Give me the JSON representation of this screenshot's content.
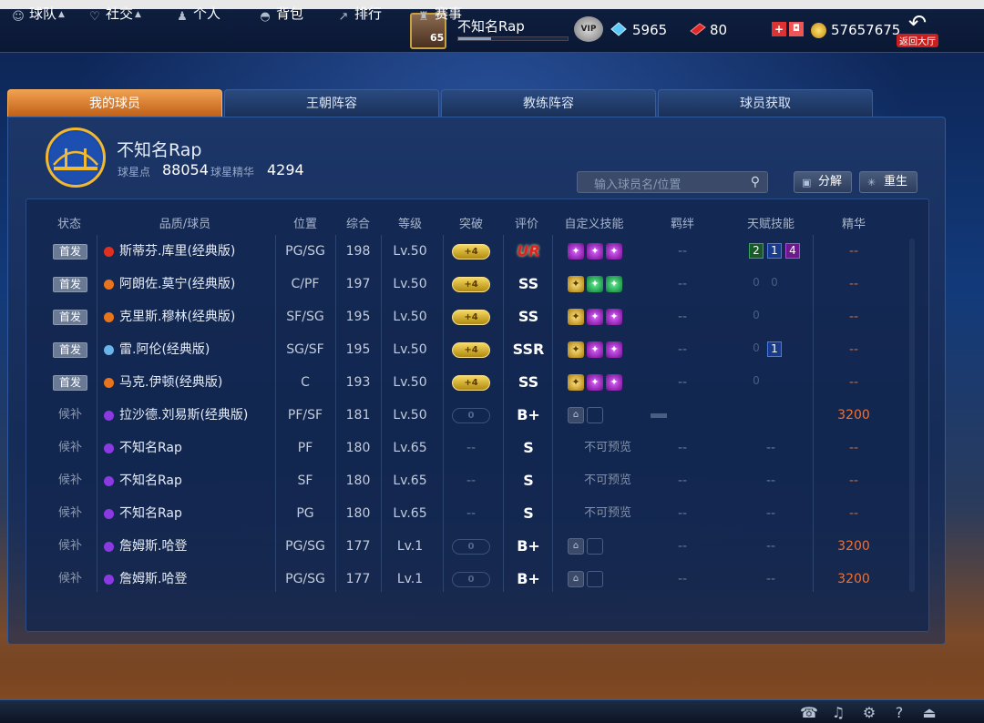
{
  "header": {
    "player_name": "不知名Rap",
    "level": "65",
    "vip_label": "VIP",
    "diamonds": "5965",
    "tickets": "80",
    "coins": "57657675",
    "back_label": "返回大厅",
    "icons": [
      "avatar",
      "vip-badge-icon",
      "diamond-icon",
      "ticket-icon",
      "shop-icon",
      "coin-icon",
      "back-arrow-icon"
    ]
  },
  "tabs": [
    {
      "label": "我的球员",
      "active": true
    },
    {
      "label": "王朝阵容",
      "active": false
    },
    {
      "label": "教练阵容",
      "active": false
    },
    {
      "label": "球员获取",
      "active": false
    }
  ],
  "team": {
    "name": "不知名Rap",
    "points_label": "球星点",
    "points": "88054",
    "essence_label": "球星精华",
    "essence": "4294"
  },
  "search": {
    "placeholder": "输入球员名/位置"
  },
  "actions": {
    "decompose": "分解",
    "rebirth": "重生"
  },
  "columns": [
    "状态",
    "品质/球员",
    "位置",
    "综合",
    "等级",
    "突破",
    "评价",
    "自定义技能",
    "羁绊",
    "天赋技能",
    "精华"
  ],
  "colors": {
    "active_tab": "#e07a2a",
    "essence_orange": "#f07030",
    "quality_red": "#e03020",
    "quality_orange": "#e8741e",
    "quality_blue": "#6ab4e8",
    "quality_purple": "#8a3ae0"
  },
  "rows": [
    {
      "status": "首发",
      "starter": true,
      "quality": "#e03020",
      "name": "斯蒂芬.库里(经典版)",
      "position": "PG/SG",
      "overall": "198",
      "level": "Lv.50",
      "breakthrough": "+4",
      "grade": "UR",
      "skills": [
        "purple",
        "purple",
        "purple"
      ],
      "skills_text": "",
      "bond": "--",
      "talents": [
        {
          "v": "2",
          "c": "t-green"
        },
        {
          "v": "1",
          "c": "t-blue"
        },
        {
          "v": "4",
          "c": "t-purple"
        }
      ],
      "essence": "--"
    },
    {
      "status": "首发",
      "starter": true,
      "quality": "#e8741e",
      "name": "阿朗佐.莫宁(经典版)",
      "position": "C/PF",
      "overall": "197",
      "level": "Lv.50",
      "breakthrough": "+4",
      "grade": "SS",
      "skills": [
        "gold",
        "green",
        "green"
      ],
      "skills_text": "",
      "bond": "--",
      "talents": [
        {
          "v": "0",
          "c": "t-zero"
        },
        {
          "v": "0",
          "c": "t-zero"
        }
      ],
      "essence": "--"
    },
    {
      "status": "首发",
      "starter": true,
      "quality": "#e8741e",
      "name": "克里斯.穆林(经典版)",
      "position": "SF/SG",
      "overall": "195",
      "level": "Lv.50",
      "breakthrough": "+4",
      "grade": "SS",
      "skills": [
        "gold",
        "purple",
        "purple"
      ],
      "skills_text": "",
      "bond": "--",
      "talents": [
        {
          "v": "0",
          "c": "t-zero"
        }
      ],
      "essence": "--"
    },
    {
      "status": "首发",
      "starter": true,
      "quality": "#6ab4e8",
      "name": "雷.阿伦(经典版)",
      "position": "SG/SF",
      "overall": "195",
      "level": "Lv.50",
      "breakthrough": "+4",
      "grade": "SSR",
      "skills": [
        "gold",
        "purple",
        "purple"
      ],
      "skills_text": "",
      "bond": "--",
      "talents": [
        {
          "v": "0",
          "c": "t-zero"
        },
        {
          "v": "1",
          "c": "t-blue"
        }
      ],
      "essence": "--"
    },
    {
      "status": "首发",
      "starter": true,
      "quality": "#e8741e",
      "name": "马克.伊顿(经典版)",
      "position": "C",
      "overall": "193",
      "level": "Lv.50",
      "breakthrough": "+4",
      "grade": "SS",
      "skills": [
        "gold",
        "purple",
        "purple"
      ],
      "skills_text": "",
      "bond": "--",
      "talents": [
        {
          "v": "0",
          "c": "t-zero"
        }
      ],
      "essence": "--"
    },
    {
      "status": "候补",
      "starter": false,
      "quality": "#8a3ae0",
      "name": "拉沙德.刘易斯(经典版)",
      "position": "PF/SF",
      "overall": "181",
      "level": "Lv.50",
      "breakthrough": "0",
      "breakthrough_empty": true,
      "grade": "B+",
      "skills": [
        "lock",
        "empty"
      ],
      "skills_text": "",
      "bond": "bar",
      "talents": [],
      "essence": "3200"
    },
    {
      "status": "候补",
      "starter": false,
      "quality": "#8a3ae0",
      "name": "不知名Rap",
      "position": "PF",
      "overall": "180",
      "level": "Lv.65",
      "breakthrough": "--",
      "breakthrough_dash": true,
      "grade": "S",
      "skills": [],
      "skills_text": "不可预览",
      "bond": "--",
      "talents_text": "--",
      "talents": [],
      "essence": "--"
    },
    {
      "status": "候补",
      "starter": false,
      "quality": "#8a3ae0",
      "name": "不知名Rap",
      "position": "SF",
      "overall": "180",
      "level": "Lv.65",
      "breakthrough": "--",
      "breakthrough_dash": true,
      "grade": "S",
      "skills": [],
      "skills_text": "不可预览",
      "bond": "--",
      "talents_text": "--",
      "talents": [],
      "essence": "--"
    },
    {
      "status": "候补",
      "starter": false,
      "quality": "#8a3ae0",
      "name": "不知名Rap",
      "position": "PG",
      "overall": "180",
      "level": "Lv.65",
      "breakthrough": "--",
      "breakthrough_dash": true,
      "grade": "S",
      "skills": [],
      "skills_text": "不可预览",
      "bond": "--",
      "talents_text": "--",
      "talents": [],
      "essence": "--"
    },
    {
      "status": "候补",
      "starter": false,
      "quality": "#8a3ae0",
      "name": "詹姆斯.哈登",
      "position": "PG/SG",
      "overall": "177",
      "level": "Lv.1",
      "breakthrough": "0",
      "breakthrough_empty": true,
      "grade": "B+",
      "skills": [
        "lock",
        "empty"
      ],
      "skills_text": "",
      "bond": "--",
      "talents_text": "--",
      "talents": [],
      "essence": "3200"
    },
    {
      "status": "候补",
      "starter": false,
      "quality": "#8a3ae0",
      "name": "詹姆斯.哈登",
      "position": "PG/SG",
      "overall": "177",
      "level": "Lv.1",
      "breakthrough": "0",
      "breakthrough_empty": true,
      "grade": "B+",
      "skills": [
        "lock",
        "empty"
      ],
      "skills_text": "",
      "bond": "--",
      "talents_text": "--",
      "talents": [],
      "essence": "3200"
    }
  ],
  "bottom_nav": [
    {
      "label": "球队",
      "icon": "person-icon",
      "caret": true
    },
    {
      "label": "社交",
      "icon": "heart-icon",
      "caret": true
    },
    {
      "label": "个人",
      "icon": "user-icon",
      "caret": false
    },
    {
      "label": "背包",
      "icon": "bag-icon",
      "caret": false
    },
    {
      "label": "排行",
      "icon": "ranking-icon",
      "caret": false
    },
    {
      "label": "赛事",
      "icon": "trophy-icon",
      "caret": false
    }
  ],
  "bottom_right_icons": [
    "support-icon",
    "music-icon",
    "settings-icon",
    "help-icon",
    "exit-icon"
  ]
}
